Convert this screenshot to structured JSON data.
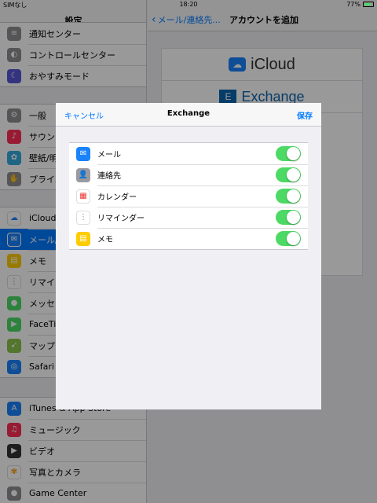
{
  "status": {
    "carrier": "SIMなし",
    "time": "18:20",
    "battery": "77%",
    "battery_level": 0.77
  },
  "master": {
    "title": "設定",
    "groups": [
      {
        "items": [
          {
            "label": "通知センター",
            "icon": "notification-icon",
            "color": "#8e8e93"
          },
          {
            "label": "コントロールセンター",
            "icon": "control-center-icon",
            "color": "#8e8e93"
          },
          {
            "label": "おやすみモード",
            "icon": "moon-icon",
            "color": "#5856d6"
          }
        ]
      },
      {
        "items": [
          {
            "label": "一般",
            "icon": "gear-icon",
            "color": "#8e8e93"
          },
          {
            "label": "サウンド",
            "icon": "sound-icon",
            "color": "#ff2d55"
          },
          {
            "label": "壁紙/明るさ",
            "icon": "wallpaper-icon",
            "color": "#34aadc"
          },
          {
            "label": "プライバシー",
            "icon": "hand-icon",
            "color": "#8e8e93"
          }
        ]
      },
      {
        "items": [
          {
            "label": "iCloud",
            "icon": "icloud-icon",
            "color": "#8e8e93"
          },
          {
            "label": "メール/連絡先/カレンダー",
            "icon": "mail-icon",
            "color": "#1a82fb",
            "selected": true
          },
          {
            "label": "メモ",
            "icon": "notes-icon",
            "color": "#ffcc00"
          },
          {
            "label": "リマインダー",
            "icon": "reminders-icon",
            "color": "#ffffff"
          },
          {
            "label": "メッセージ",
            "icon": "messages-icon",
            "color": "#4cd964"
          },
          {
            "label": "FaceTime",
            "icon": "facetime-icon",
            "color": "#4cd964"
          },
          {
            "label": "マップ",
            "icon": "maps-icon",
            "color": "#8ac34a"
          },
          {
            "label": "Safari",
            "icon": "safari-icon",
            "color": "#1a82fb"
          }
        ]
      },
      {
        "items": [
          {
            "label": "iTunes & App Store",
            "icon": "app-store-icon",
            "color": "#1a82fb"
          },
          {
            "label": "ミュージック",
            "icon": "music-icon",
            "color": "#ff2d55"
          },
          {
            "label": "ビデオ",
            "icon": "video-icon",
            "color": "#333333"
          },
          {
            "label": "写真とカメラ",
            "icon": "photos-icon",
            "color": "#ff9500"
          },
          {
            "label": "Game Center",
            "icon": "game-center-icon",
            "color": "#8e8e93"
          }
        ]
      }
    ]
  },
  "detail": {
    "back_label": "メール/連絡先...",
    "title": "アカウントを追加",
    "providers": [
      "iCloud",
      "Exchange"
    ]
  },
  "modal": {
    "cancel_label": "キャンセル",
    "title": "Exchange",
    "save_label": "保存",
    "items": [
      {
        "label": "メール",
        "icon": "mail-icon",
        "color": "#1a82fb",
        "on": true
      },
      {
        "label": "連絡先",
        "icon": "contacts-icon",
        "color": "#9a9a9f",
        "on": true
      },
      {
        "label": "カレンダー",
        "icon": "calendar-icon",
        "color": "#ffffff",
        "on": true
      },
      {
        "label": "リマインダー",
        "icon": "reminders-icon",
        "color": "#ffffff",
        "on": true
      },
      {
        "label": "メモ",
        "icon": "notes-icon",
        "color": "#ffcc00",
        "on": true
      }
    ]
  }
}
